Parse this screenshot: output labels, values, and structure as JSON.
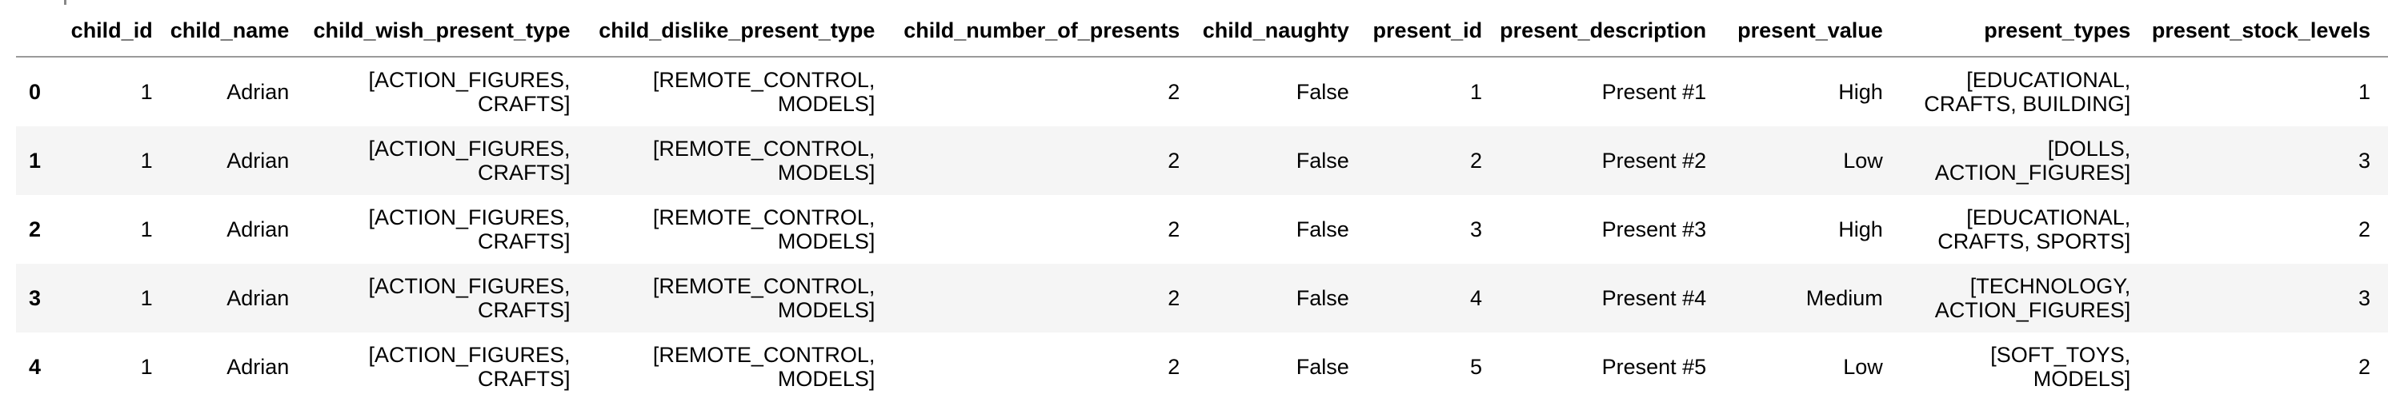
{
  "table": {
    "columns": [
      "",
      "child_id",
      "child_name",
      "child_wish_present_type",
      "child_dislike_present_type",
      "child_number_of_presents",
      "child_naughty",
      "present_id",
      "present_description",
      "present_value",
      "present_types",
      "present_stock_levels"
    ],
    "rows": [
      {
        "index": "0",
        "child_id": "1",
        "child_name": "Adrian",
        "child_wish_present_type": [
          "[ACTION_FIGURES,",
          "CRAFTS]"
        ],
        "child_dislike_present_type": [
          "[REMOTE_CONTROL,",
          "MODELS]"
        ],
        "child_number_of_presents": "2",
        "child_naughty": "False",
        "present_id": "1",
        "present_description": "Present #1",
        "present_value": "High",
        "present_types": [
          "[EDUCATIONAL,",
          "CRAFTS, BUILDING]"
        ],
        "present_stock_levels": "1"
      },
      {
        "index": "1",
        "child_id": "1",
        "child_name": "Adrian",
        "child_wish_present_type": [
          "[ACTION_FIGURES,",
          "CRAFTS]"
        ],
        "child_dislike_present_type": [
          "[REMOTE_CONTROL,",
          "MODELS]"
        ],
        "child_number_of_presents": "2",
        "child_naughty": "False",
        "present_id": "2",
        "present_description": "Present #2",
        "present_value": "Low",
        "present_types": [
          "[DOLLS,",
          "ACTION_FIGURES]"
        ],
        "present_stock_levels": "3"
      },
      {
        "index": "2",
        "child_id": "1",
        "child_name": "Adrian",
        "child_wish_present_type": [
          "[ACTION_FIGURES,",
          "CRAFTS]"
        ],
        "child_dislike_present_type": [
          "[REMOTE_CONTROL,",
          "MODELS]"
        ],
        "child_number_of_presents": "2",
        "child_naughty": "False",
        "present_id": "3",
        "present_description": "Present #3",
        "present_value": "High",
        "present_types": [
          "[EDUCATIONAL,",
          "CRAFTS, SPORTS]"
        ],
        "present_stock_levels": "2"
      },
      {
        "index": "3",
        "child_id": "1",
        "child_name": "Adrian",
        "child_wish_present_type": [
          "[ACTION_FIGURES,",
          "CRAFTS]"
        ],
        "child_dislike_present_type": [
          "[REMOTE_CONTROL,",
          "MODELS]"
        ],
        "child_number_of_presents": "2",
        "child_naughty": "False",
        "present_id": "4",
        "present_description": "Present #4",
        "present_value": "Medium",
        "present_types": [
          "[TECHNOLOGY,",
          "ACTION_FIGURES]"
        ],
        "present_stock_levels": "3"
      },
      {
        "index": "4",
        "child_id": "1",
        "child_name": "Adrian",
        "child_wish_present_type": [
          "[ACTION_FIGURES,",
          "CRAFTS]"
        ],
        "child_dislike_present_type": [
          "[REMOTE_CONTROL,",
          "MODELS]"
        ],
        "child_number_of_presents": "2",
        "child_naughty": "False",
        "present_id": "5",
        "present_description": "Present #5",
        "present_value": "Low",
        "present_types": [
          "[SOFT_TOYS,",
          "MODELS]"
        ],
        "present_stock_levels": "2"
      }
    ]
  }
}
